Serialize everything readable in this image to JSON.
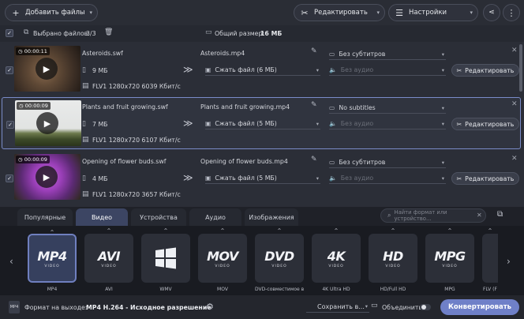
{
  "toolbar": {
    "add_files_label": "Добавить файлы",
    "edit_label": "Редактировать",
    "settings_label": "Настройки"
  },
  "files_bar": {
    "selected_label": "Выбрано файлов:",
    "selected_value": "3/3",
    "total_label": "Общий размер:",
    "total_value": "16 МБ"
  },
  "files": [
    {
      "duration": "00:00:11",
      "source_name": "Asteroids.swf",
      "source_size": "9 МБ",
      "source_info": "FLV1 1280x720 6039 Кбит/с",
      "output_name": "Asteroids.mp4",
      "compress": "Сжать файл (6 МБ)",
      "subtitles": "Без субтитров",
      "audio": "Без аудио",
      "edit_label": "Редактировать"
    },
    {
      "duration": "00:00:09",
      "source_name": "Plants and fruit growing.swf",
      "source_size": "7 МБ",
      "source_info": "FLV1 1280x720 6107 Кбит/с",
      "output_name": "Plants and fruit growing.mp4",
      "compress": "Сжать файл (5 МБ)",
      "subtitles": "No subtitles",
      "audio": "Без аудио",
      "edit_label": "Редактировать"
    },
    {
      "duration": "00:00:09",
      "source_name": "Opening of flower buds.swf",
      "source_size": "4 МБ",
      "source_info": "FLV1 1280x720 3657 Кбит/с",
      "output_name": "Opening of flower buds.mp4",
      "compress": "Сжать файл (5 МБ)",
      "subtitles": "Без субтитров",
      "audio": "Без аудио",
      "edit_label": "Редактировать"
    }
  ],
  "tabs": [
    "Популярные",
    "Видео",
    "Устройства",
    "Аудио",
    "Изображения"
  ],
  "active_tab": "Видео",
  "search": {
    "placeholder": "Найти формат или устройство..."
  },
  "formats": [
    {
      "logo": "MP4",
      "sub": "VIDEO",
      "caption": "MP4"
    },
    {
      "logo": "AVI",
      "sub": "VIDEO",
      "caption": "AVI"
    },
    {
      "logo": "",
      "sub": "",
      "caption": "WMV"
    },
    {
      "logo": "MOV",
      "sub": "VIDEO",
      "caption": "MOV"
    },
    {
      "logo": "DVD",
      "sub": "VIDEO",
      "caption": "DVD-совместимое в..."
    },
    {
      "logo": "4K",
      "sub": "VIDEO",
      "caption": "4K Ultra HD"
    },
    {
      "logo": "HD",
      "sub": "VIDEO",
      "caption": "HD/Full HD"
    },
    {
      "logo": "MPG",
      "sub": "VIDEO",
      "caption": "MPG"
    },
    {
      "logo": "",
      "sub": "",
      "caption": "FLV (F"
    }
  ],
  "bottom": {
    "output_label": "Формат на выходе:",
    "output_value": "MP4 H.264 - Исходное разрешение",
    "save_label": "Сохранить в...",
    "merge_label": "Объединить:",
    "convert_label": "Конвертировать"
  },
  "colors": {
    "accent": "#6f80c8",
    "selected_border": "#7a8cc9"
  }
}
